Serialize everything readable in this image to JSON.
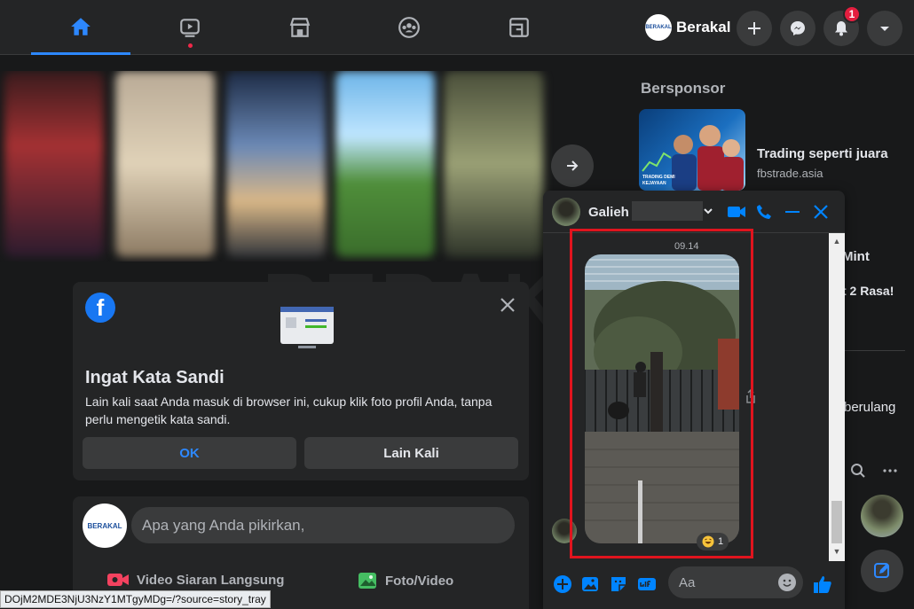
{
  "nav": {
    "profile_name": "Berakal",
    "profile_logo_text": "BERAKAL",
    "notification_count": "1"
  },
  "card": {
    "title": "Ingat Kata Sandi",
    "description": "Lain kali saat Anda masuk di browser ini, cukup klik foto profil Anda, tanpa perlu mengetik kata sandi.",
    "ok_label": "OK",
    "later_label": "Lain Kali"
  },
  "composer": {
    "avatar_text": "BERAKAL",
    "placeholder": "Apa yang Anda pikirkan,",
    "live_label": "Video Siaran Langsung",
    "photo_label": "Foto/Video"
  },
  "status_url": "DOjM2MDE3NjU3NzY1MTgyMDg=/?source=story_tray",
  "sponsor": {
    "heading": "Bersponsor",
    "ad_headline": "Trading seperti juara",
    "ad_domain": "fbstrade.asia",
    "ad_image_text": "TRADING DEMI KEJAYAAN"
  },
  "right_partial": {
    "line1": "Mint",
    "line2": "t 2 Rasa!",
    "line3": "berulang"
  },
  "chat": {
    "contact_name": "Galieh",
    "timestamp": "09.14",
    "reaction_count": "1",
    "input_placeholder": "Aa"
  },
  "watermark": "BERAKAL",
  "colors": {
    "accent": "#2d88ff",
    "highlight_box": "#e0141e",
    "badge": "#e41e3f",
    "messenger_blue": "#0084ff"
  }
}
